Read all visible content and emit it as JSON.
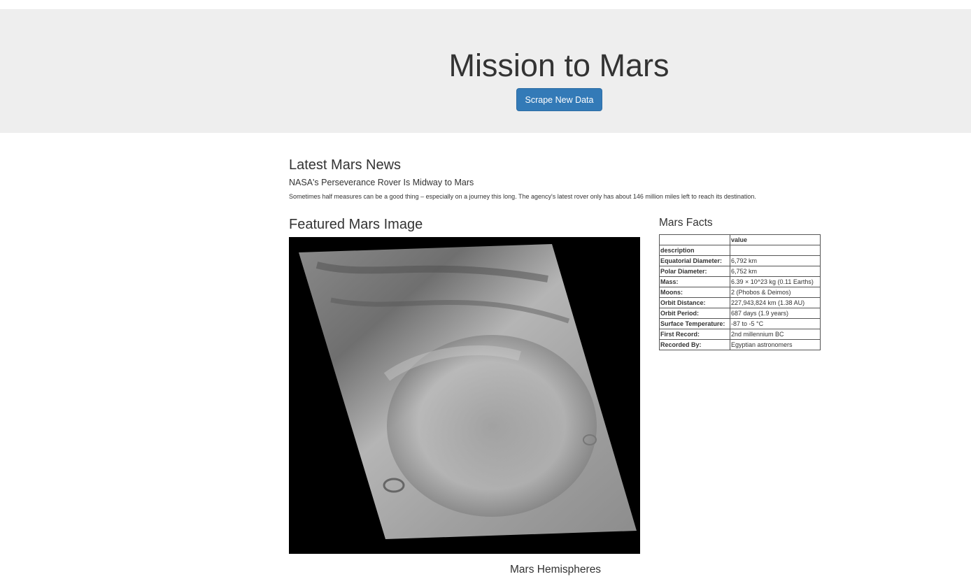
{
  "header": {
    "title": "Mission to Mars",
    "scrape_button": "Scrape New Data"
  },
  "news": {
    "heading": "Latest Mars News",
    "title": "NASA's Perseverance Rover Is Midway to Mars",
    "teaser": "Sometimes half measures can be a good thing – especially on a journey this long. The agency's latest rover only has about 146 million miles left to reach its destination."
  },
  "featured": {
    "heading": "Featured Mars Image"
  },
  "facts": {
    "heading": "Mars Facts",
    "columns": [
      "",
      "value"
    ],
    "index_label": "description",
    "rows": [
      {
        "label": "Equatorial Diameter:",
        "value": "6,792 km"
      },
      {
        "label": "Polar Diameter:",
        "value": "6,752 km"
      },
      {
        "label": "Mass:",
        "value": "6.39 × 10^23 kg (0.11 Earths)"
      },
      {
        "label": "Moons:",
        "value": "2 (Phobos & Deimos)"
      },
      {
        "label": "Orbit Distance:",
        "value": "227,943,824 km (1.38 AU)"
      },
      {
        "label": "Orbit Period:",
        "value": "687 days (1.9 years)"
      },
      {
        "label": "Surface Temperature:",
        "value": "-87 to -5 °C"
      },
      {
        "label": "First Record:",
        "value": "2nd millennium BC"
      },
      {
        "label": "Recorded By:",
        "value": "Egyptian astronomers"
      }
    ]
  },
  "hemispheres": {
    "heading": "Mars Hemispheres"
  }
}
